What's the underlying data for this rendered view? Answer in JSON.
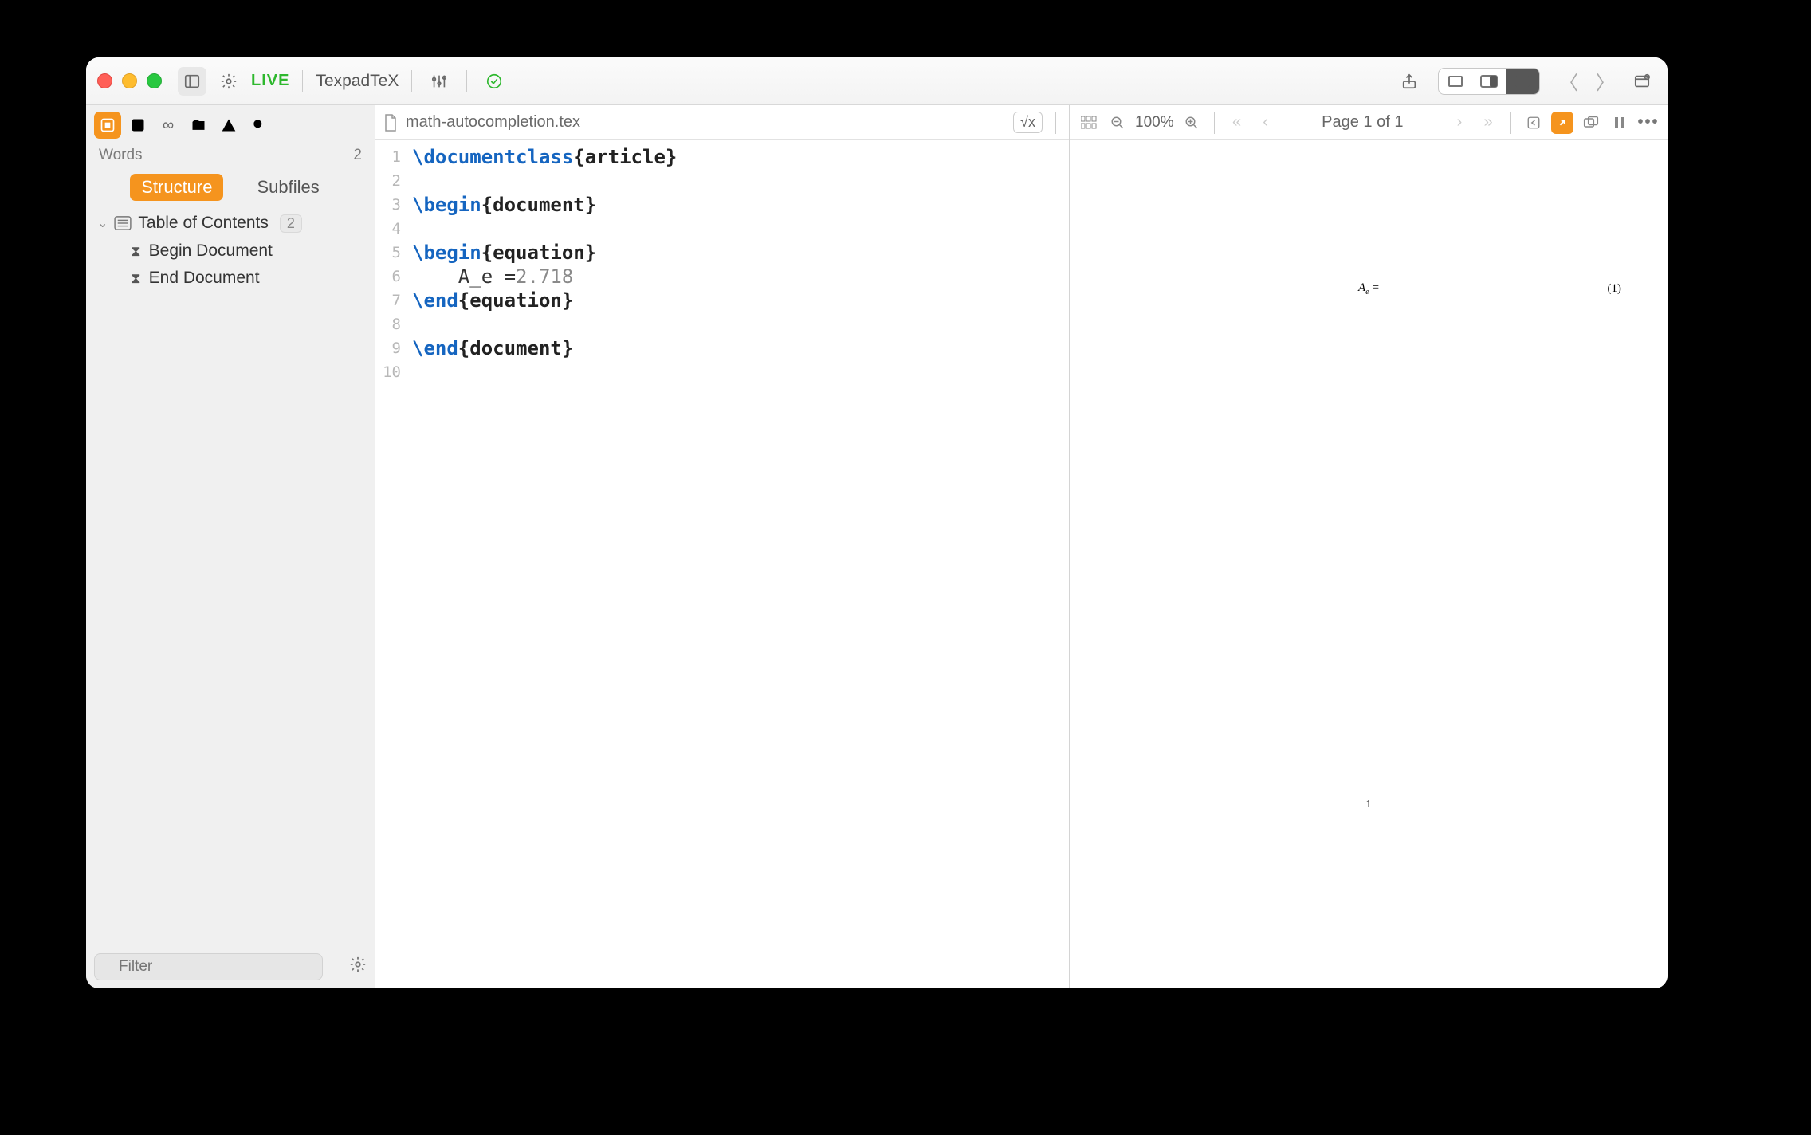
{
  "toolbar": {
    "live": "LIVE",
    "engine": "TexpadTeX"
  },
  "sidebar": {
    "words_label": "Words",
    "words_count": "2",
    "tabs": {
      "structure": "Structure",
      "subfiles": "Subfiles"
    },
    "toc_label": "Table of Contents",
    "toc_badge": "2",
    "items": [
      {
        "label": "Begin Document"
      },
      {
        "label": "End Document"
      }
    ],
    "filter_placeholder": "Filter"
  },
  "editor": {
    "filename": "math-autocompletion.tex",
    "gutter": [
      "1",
      "2",
      "3",
      "4",
      "5",
      "6",
      "7",
      "8",
      "9",
      "10"
    ],
    "lines": {
      "l1_cmd": "\\documentclass",
      "l1_arg": "{article}",
      "l3_cmd": "\\begin",
      "l3_arg": "{document}",
      "l5_cmd": "\\begin",
      "l5_arg": "{equation}",
      "l6_txt": "    A_e =",
      "l6_num": "2.718",
      "l7_cmd": "\\end",
      "l7_arg": "{equation}",
      "l9_cmd": "\\end",
      "l9_arg": "{document}"
    }
  },
  "preview": {
    "zoom": "100%",
    "page_label": "Page 1 of 1",
    "equation_lhs": "A",
    "equation_sub": "e",
    "equation_rhs": " =",
    "equation_num": "(1)",
    "page_number": "1"
  }
}
